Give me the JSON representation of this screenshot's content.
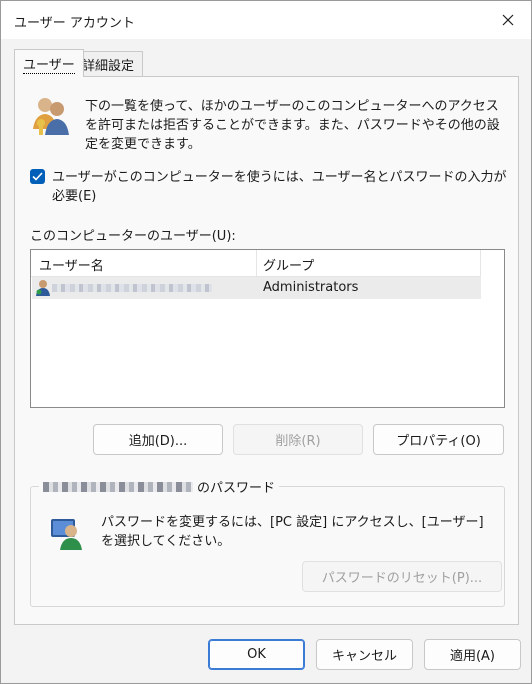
{
  "window": {
    "title": "ユーザー アカウント"
  },
  "tabs": [
    {
      "label": "ユーザー",
      "active": true
    },
    {
      "label": "詳細設定",
      "active": false
    }
  ],
  "users_tab": {
    "description": "下の一覧を使って、ほかのユーザーのこのコンピューターへのアクセスを許可または拒否することができます。また、パスワードやその他の設定を変更できます。",
    "require_login_checkbox": {
      "label": "ユーザーがこのコンピューターを使うには、ユーザー名とパスワードの入力が必要(E)",
      "checked": true
    },
    "users_list": {
      "label": "このコンピューターのユーザー(U):",
      "columns": [
        "ユーザー名",
        "グループ"
      ],
      "rows": [
        {
          "group": "Administrators"
        }
      ]
    },
    "buttons": {
      "add": "追加(D)...",
      "remove": "削除(R)",
      "properties": "プロパティ(O)"
    },
    "password_group": {
      "legend_suffix": "のパスワード",
      "description": "パスワードを変更するには、[PC 設定] にアクセスし、[ユーザー] を選択してください。",
      "reset_button": "パスワードのリセット(P)..."
    }
  },
  "footer": {
    "ok": "OK",
    "cancel": "キャンセル",
    "apply": "適用(A)"
  },
  "colors": {
    "accent": "#005fb8",
    "window_bg": "#f3f3f3",
    "panel_bg": "#f9f9f9",
    "selected_row": "#ebebeb"
  }
}
